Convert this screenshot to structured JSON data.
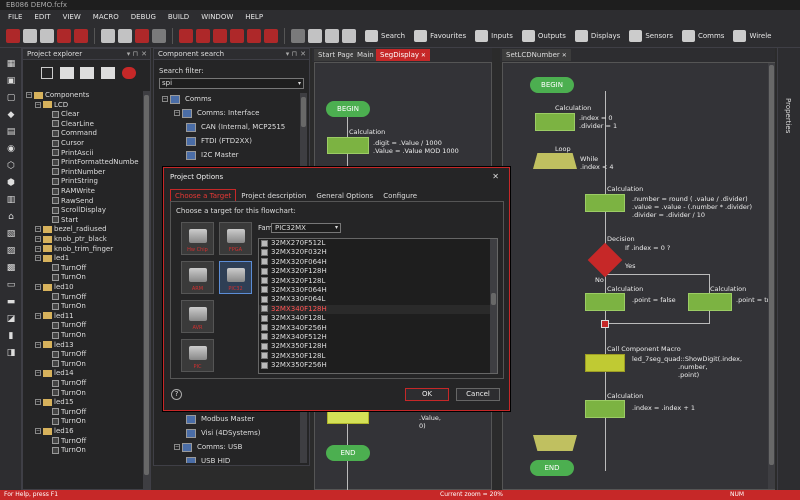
{
  "window": {
    "title": "EB086 DEMO.fcfx"
  },
  "menu": [
    "FILE",
    "EDIT",
    "VIEW",
    "MACRO",
    "DEBUG",
    "BUILD",
    "WINDOW",
    "HELP"
  ],
  "toolbar": {
    "labels": [
      "Search",
      "Favourites",
      "Inputs",
      "Outputs",
      "Displays",
      "Sensors",
      "Comms",
      "Wirele"
    ]
  },
  "explorer": {
    "title": "Project explorer",
    "items": [
      {
        "label": "Components",
        "level": 0,
        "kind": "folder"
      },
      {
        "label": "LCD",
        "level": 1,
        "kind": "folder"
      },
      {
        "label": "Clear",
        "level": 2,
        "kind": "leaf"
      },
      {
        "label": "ClearLine",
        "level": 2,
        "kind": "leaf"
      },
      {
        "label": "Command",
        "level": 2,
        "kind": "leaf"
      },
      {
        "label": "Cursor",
        "level": 2,
        "kind": "leaf"
      },
      {
        "label": "PrintAscii",
        "level": 2,
        "kind": "leaf"
      },
      {
        "label": "PrintFormattedNumbe",
        "level": 2,
        "kind": "leaf"
      },
      {
        "label": "PrintNumber",
        "level": 2,
        "kind": "leaf"
      },
      {
        "label": "PrintString",
        "level": 2,
        "kind": "leaf"
      },
      {
        "label": "RAMWrite",
        "level": 2,
        "kind": "leaf"
      },
      {
        "label": "RawSend",
        "level": 2,
        "kind": "leaf"
      },
      {
        "label": "ScrollDisplay",
        "level": 2,
        "kind": "leaf"
      },
      {
        "label": "Start",
        "level": 2,
        "kind": "leaf"
      },
      {
        "label": "bezel_radiused",
        "level": 1,
        "kind": "folder"
      },
      {
        "label": "knob_ptr_black",
        "level": 1,
        "kind": "folder"
      },
      {
        "label": "knob_trim_finger",
        "level": 1,
        "kind": "folder"
      },
      {
        "label": "led1",
        "level": 1,
        "kind": "folder"
      },
      {
        "label": "TurnOff",
        "level": 2,
        "kind": "leaf"
      },
      {
        "label": "TurnOn",
        "level": 2,
        "kind": "leaf"
      },
      {
        "label": "led10",
        "level": 1,
        "kind": "folder"
      },
      {
        "label": "TurnOff",
        "level": 2,
        "kind": "leaf"
      },
      {
        "label": "TurnOn",
        "level": 2,
        "kind": "leaf"
      },
      {
        "label": "led11",
        "level": 1,
        "kind": "folder"
      },
      {
        "label": "TurnOff",
        "level": 2,
        "kind": "leaf"
      },
      {
        "label": "TurnOn",
        "level": 2,
        "kind": "leaf"
      },
      {
        "label": "led13",
        "level": 1,
        "kind": "folder"
      },
      {
        "label": "TurnOff",
        "level": 2,
        "kind": "leaf"
      },
      {
        "label": "TurnOn",
        "level": 2,
        "kind": "leaf"
      },
      {
        "label": "led14",
        "level": 1,
        "kind": "folder"
      },
      {
        "label": "TurnOff",
        "level": 2,
        "kind": "leaf"
      },
      {
        "label": "TurnOn",
        "level": 2,
        "kind": "leaf"
      },
      {
        "label": "led15",
        "level": 1,
        "kind": "folder"
      },
      {
        "label": "TurnOff",
        "level": 2,
        "kind": "leaf"
      },
      {
        "label": "TurnOn",
        "level": 2,
        "kind": "leaf"
      },
      {
        "label": "led16",
        "level": 1,
        "kind": "folder"
      },
      {
        "label": "TurnOff",
        "level": 2,
        "kind": "leaf"
      },
      {
        "label": "TurnOn",
        "level": 2,
        "kind": "leaf"
      }
    ]
  },
  "component_search": {
    "title": "Component search",
    "filter_label": "Search filter:",
    "filter_value": "spi",
    "items": [
      {
        "label": "Comms",
        "level": 0
      },
      {
        "label": "Comms: Interface",
        "level": 1
      },
      {
        "label": "CAN (Internal, MCP2515",
        "level": 2
      },
      {
        "label": "FTDI (FTD2XX)",
        "level": 2
      },
      {
        "label": "I2C Master",
        "level": 2
      }
    ],
    "items_bottom": [
      {
        "label": "Modbus Master",
        "level": 2
      },
      {
        "label": "Visi (4DSystems)",
        "level": 2
      },
      {
        "label": "Comms: USB",
        "level": 1
      },
      {
        "label": "USB HID",
        "level": 2
      }
    ]
  },
  "tabs_left": [
    "Start Page",
    "Main",
    "SegDisplay"
  ],
  "tabs_right": [
    "SetLCDNumber"
  ],
  "flow_left": {
    "begin": "BEGIN",
    "calc_title": "Calculation",
    "calc_line1": ".digit = .Value / 1000",
    "calc_line2": ".Value = .Value MOD 1000",
    "lower_text1": ".Value,",
    "lower_text2": "0)",
    "end": "END"
  },
  "flow_right": {
    "begin": "BEGIN",
    "calc1_title": "Calculation",
    "calc1_l1": ".index = 0",
    "calc1_l2": ".divider = 1",
    "loop": "Loop",
    "while_l1": "While",
    "while_l2": ".index < 4",
    "calc2_title": "Calculation",
    "calc2_l1": ".number = round ( .value / .divider)",
    "calc2_l2": ".value = .value - (.number * .divider)",
    "calc2_l3": ".divider = .divider / 10",
    "decision_title": "Decision",
    "decision_q": "If .index = 0 ?",
    "yes": "Yes",
    "no": "No",
    "calc3_title": "Calculation",
    "calc3_l1": ".point = false",
    "calc4_title": "Calculation",
    "calc4_l1": ".point = tru",
    "macro_title": "Call Component Macro",
    "macro_l1": "led_7seg_quad::ShowDigit(.index,",
    "macro_l2": ".number,",
    "macro_l3": ".point)",
    "calc5_title": "Calculation",
    "calc5_l1": ".index = .index + 1",
    "end": "END"
  },
  "properties_label": "Properties",
  "dialog": {
    "title": "Project Options",
    "tabs": [
      "Choose a Target",
      "Project description",
      "General Options",
      "Configure"
    ],
    "choose_label": "Choose a target for this flowchart:",
    "family_label": "Family",
    "family_value": "PIC32MX",
    "targets": [
      "Hw Chip",
      "FPGA",
      "ARM",
      "PIC32",
      "AVR",
      "PIC"
    ],
    "chips": [
      "32MX270F512L",
      "32MX320F032H",
      "32MX320F064H",
      "32MX320F128H",
      "32MX320F128L",
      "32MX330F064H",
      "32MX330F064L",
      "32MX340F128H",
      "32MX340F128L",
      "32MX340F256H",
      "32MX340F512H",
      "32MX350F128H",
      "32MX350F128L",
      "32MX350F256H"
    ],
    "selected_chip": "32MX340F128H",
    "help": "?",
    "ok": "OK",
    "cancel": "Cancel"
  },
  "status": {
    "left": "For Help, press F1",
    "mid": "Current zoom = 20%",
    "right": "NUM"
  },
  "colors": {
    "accent": "#c62828",
    "flow_green": "#4caf50",
    "calc_green": "#7cb342",
    "decision_red": "#c62828"
  }
}
